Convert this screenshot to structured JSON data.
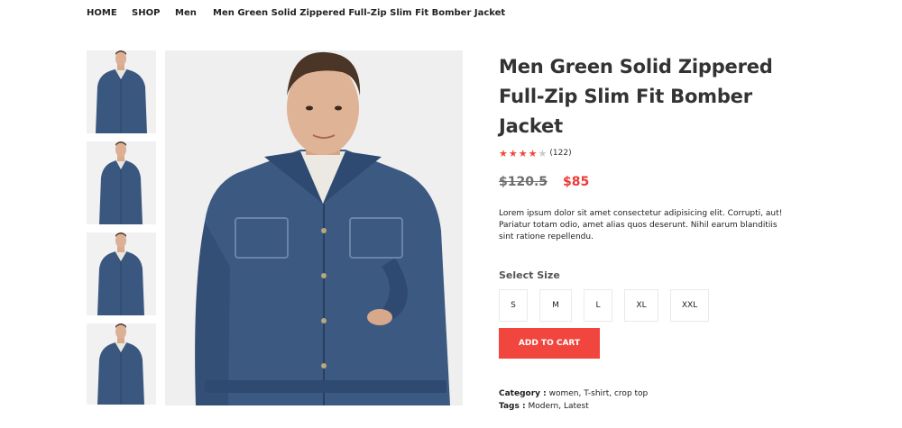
{
  "breadcrumb": {
    "home": "HOME",
    "shop": "SHOP",
    "category": "Men",
    "current": "Men Green Solid Zippered Full-Zip Slim Fit Bomber Jacket"
  },
  "product": {
    "title": "Men Green Solid Zippered Full-Zip Slim Fit Bomber Jacket",
    "rating": 4,
    "rating_max": 5,
    "review_count": "(122)",
    "old_price": "$120.5",
    "new_price": "$85",
    "description": "Lorem ipsum dolor sit amet consectetur adipisicing elit. Corrupti, aut! Pariatur totam odio, amet alias quos deserunt. Nihil earum blanditiis sint ratione repellendu.",
    "size_label": "Select Size",
    "sizes": [
      "S",
      "M",
      "L",
      "XL",
      "XXL"
    ],
    "cart_label": "ADD TO CART",
    "category_label": "Category :",
    "category_value": "women, T-shirt, crop top",
    "tags_label": "Tags :",
    "tags_value": "Modern, Latest"
  },
  "colors": {
    "accent": "#f0463e",
    "sale_price": "#ef3a35",
    "star": "#ef4a3c",
    "denim": "#3a5780"
  }
}
